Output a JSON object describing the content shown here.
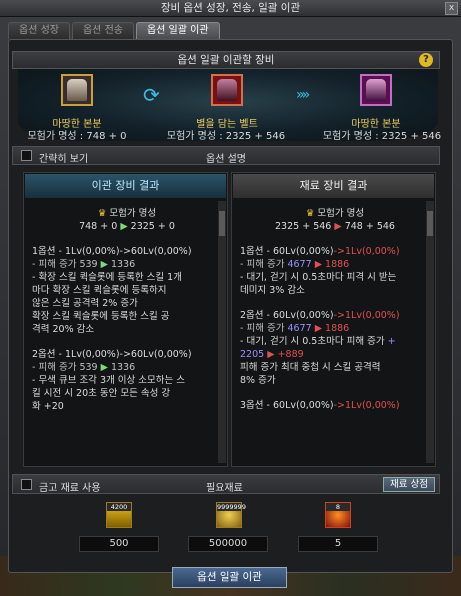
{
  "window": {
    "title": "장비 옵션 성장, 전송, 일괄 이관",
    "close_label": "x"
  },
  "tabs": [
    {
      "label": "옵션 성장"
    },
    {
      "label": "옵션 전송"
    },
    {
      "label": "옵션 일괄 이관"
    }
  ],
  "header": {
    "title": "옵션 일괄 이관할 장비",
    "help": "?"
  },
  "source_item": {
    "name": "마땅한 본분",
    "stat": "모험가 명성 : 748 + 0"
  },
  "material_item": {
    "name": "별을 담는 벨트",
    "stat": "모험가 명성 : 2325 + 546"
  },
  "result_item": {
    "name": "마땅한 본분",
    "stat": "모험가 명성 : 2325 + 546"
  },
  "options_bar": {
    "simple_view": "간략히 보기",
    "desc": "옵션 설명"
  },
  "left_panel": {
    "title": "이관 장비 결과",
    "fame_label": "모험가 명성",
    "fame_a": "748 + 0",
    "fame_arrow": "▶",
    "fame_b": "2325 + 0",
    "opt1_head": "1옵션 - 1Lv(0,00%)->60Lv(0,00%)",
    "opt1_dmg_label": "- 피해 증가 539",
    "opt1_dmg_arrow": "▶",
    "opt1_dmg_new": "1336",
    "opt1_l1": "- 확장 스킬 퀵슬롯에 등록한 스킬 1개",
    "opt1_l2": "마다 확장 스킬 퀵슬롯에 등록하지",
    "opt1_l3": "않은 스킬 공격력 2% 증가",
    "opt1_l4": "확장 스킬 퀵슬롯에 등록한 스킬 공",
    "opt1_l5": "격력 20% 감소",
    "opt2_head": "2옵션 - 1Lv(0,00%)->60Lv(0,00%)",
    "opt2_dmg_label": "- 피해 증가 539",
    "opt2_dmg_arrow": "▶",
    "opt2_dmg_new": "1336",
    "opt2_l1": "- 무색 큐브 조각 3개 이상 소모하는 스",
    "opt2_l2": "킬 시전 시 20초 동안 모든 속성 강",
    "opt2_l3": "화 +20"
  },
  "right_panel": {
    "title": "재료 장비 결과",
    "fame_label": "모험가 명성",
    "fame_a": "2325 + 546",
    "fame_arrow": "▶",
    "fame_b": "748 + 546",
    "opt1_head_a": "1옵션 - 60Lv(0,00%)",
    "opt1_head_b": "->1Lv(0,00%)",
    "opt1_dmg_label": "- 피해 증가",
    "opt1_dmg_old": "4677",
    "opt1_dmg_arrow": "▶",
    "opt1_dmg_new": "1886",
    "opt1_l1": "- 대기, 걷기 시 0.5초마다 피격 시 받는",
    "opt1_l2": "데미지 3% 감소",
    "opt2_head_a": "2옵션 - 60Lv(0,00%)",
    "opt2_head_b": "->1Lv(0,00%)",
    "opt2_dmg_label": "- 피해 증가",
    "opt2_dmg_old": "4677",
    "opt2_dmg_arrow": "▶",
    "opt2_dmg_new": "1886",
    "opt2_l1_a": "- 대기, 걷기 시 0.5초마다 피해 증가",
    "opt2_l1_b": "+",
    "opt2_l2_a": "2205",
    "opt2_l2_arrow": "▶",
    "opt2_l2_b": "+889",
    "opt2_l3": "피해 증가 최대 중첩 시 스킬 공격력",
    "opt2_l4": "8% 증가",
    "opt3_head_a": "3옵션 - 60Lv(0,00%)",
    "opt3_head_b": "->1Lv(0,00%)"
  },
  "materials_bar": {
    "use_gold": "금고 재료 사용",
    "title": "필요재료",
    "shop_button": "재료 상점"
  },
  "materials": [
    {
      "icon": "crystal-cube-icon",
      "tag": "4200",
      "qty": "500"
    },
    {
      "icon": "gold-coins-icon",
      "tag": "9999999",
      "qty": "500000"
    },
    {
      "icon": "fire-gem-icon",
      "tag": "8",
      "qty": "5"
    }
  ],
  "action_button": "옵션 일괄 이관"
}
